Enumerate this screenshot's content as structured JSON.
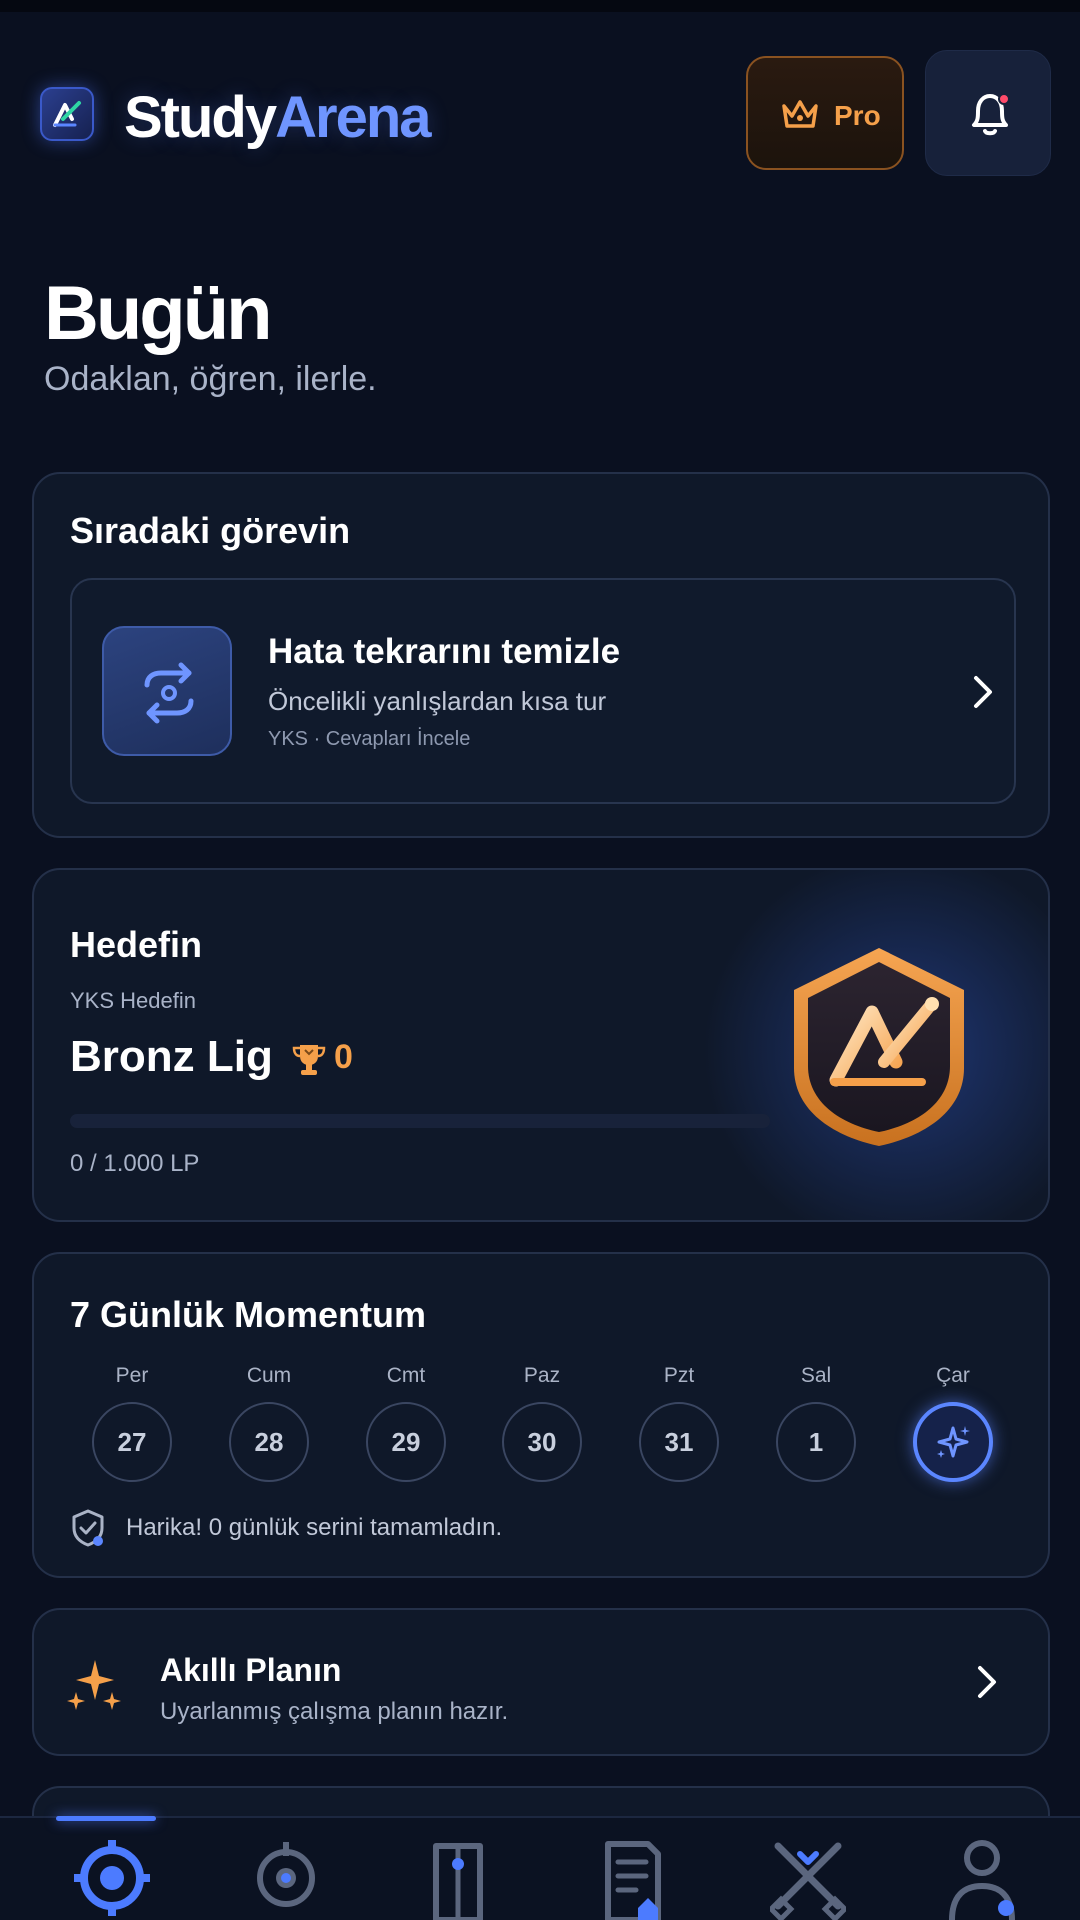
{
  "header": {
    "brand_part1": "Study",
    "brand_part2": "Arena",
    "pro_label": "Pro",
    "accent_color": "#6f95ff",
    "pro_color": "#f5a04a"
  },
  "page": {
    "title": "Bugün",
    "subtitle": "Odaklan, öğren, ilerle."
  },
  "next_task": {
    "section_title": "Sıradaki görevin",
    "title": "Hata tekrarını temizle",
    "subtitle": "Öncelikli yanlışlardan kısa tur",
    "meta": "YKS · Cevapları İncele",
    "icon": "repeat-icon"
  },
  "goal": {
    "section_title": "Hedefin",
    "label": "YKS Hedefin",
    "league": "Bronz Lig",
    "trophy_count": "0",
    "lp_text": "0 / 1.000 LP",
    "progress_fraction": 0
  },
  "momentum": {
    "title": "7 Günlük Momentum",
    "days": [
      {
        "name": "Per",
        "num": "27"
      },
      {
        "name": "Cum",
        "num": "28"
      },
      {
        "name": "Cmt",
        "num": "29"
      },
      {
        "name": "Paz",
        "num": "30"
      },
      {
        "name": "Pzt",
        "num": "31"
      },
      {
        "name": "Sal",
        "num": "1"
      },
      {
        "name": "Çar",
        "num": ""
      }
    ],
    "message": "Harika! 0 günlük serini tamamladın."
  },
  "smart_plan": {
    "title": "Akıllı Planın",
    "subtitle": "Uyarlanmış çalışma planın hazır."
  },
  "nav": {
    "items": [
      "home-icon",
      "target-icon",
      "book-icon",
      "exam-icon",
      "arena-icon",
      "profile-icon"
    ],
    "active_index": 0
  }
}
